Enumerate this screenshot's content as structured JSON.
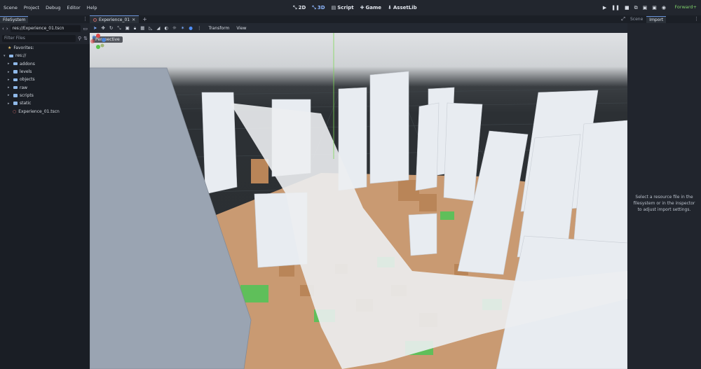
{
  "menu": [
    "Scene",
    "Project",
    "Debug",
    "Editor",
    "Help"
  ],
  "modes": [
    {
      "icon": "2d-icon",
      "glyph": "⤡",
      "label": "2D",
      "active": false
    },
    {
      "icon": "3d-icon",
      "glyph": "⤡",
      "label": "3D",
      "active": true
    },
    {
      "icon": "script-icon",
      "glyph": "▤",
      "label": "Script",
      "active": false
    },
    {
      "icon": "game-icon",
      "glyph": "✚",
      "label": "Game",
      "active": false
    },
    {
      "icon": "assetlib-icon",
      "glyph": "⬇",
      "label": "AssetLib",
      "active": false
    }
  ],
  "run_buttons": [
    {
      "icon": "play-icon",
      "glyph": "▶"
    },
    {
      "icon": "pause-icon",
      "glyph": "❚❚"
    },
    {
      "icon": "stop-icon",
      "glyph": "■"
    },
    {
      "icon": "remote-debug-icon",
      "glyph": "⧉"
    },
    {
      "icon": "play-scene-icon",
      "glyph": "▣"
    },
    {
      "icon": "play-custom-icon",
      "glyph": "▣"
    },
    {
      "icon": "movie-maker-icon",
      "glyph": "◉"
    }
  ],
  "renderer": "Forward+",
  "filesystem": {
    "tab": "FileSystem",
    "path": "res://Experience_01.tscn",
    "filter_placeholder": "Filter Files",
    "favorites": "Favorites:",
    "root": "res://",
    "folders": [
      "addons",
      "levels",
      "objects",
      "raw",
      "scripts",
      "static"
    ],
    "file": "Experience_01.tscn"
  },
  "viewport": {
    "tab": "Experience_01",
    "toolbar_transform": "Transform",
    "toolbar_view": "View",
    "perspective": "Perspective"
  },
  "rightdock": {
    "tabs": [
      "Scene",
      "Import"
    ],
    "active_tab": "Import",
    "message": "Select a resource file in the filesystem or in the inspector to adjust import settings."
  },
  "colors": {
    "accent": "#6a93d8",
    "renderer": "#7fd36b",
    "ground_brown": "#d2a07a",
    "ground_green": "#5fbf5a"
  }
}
